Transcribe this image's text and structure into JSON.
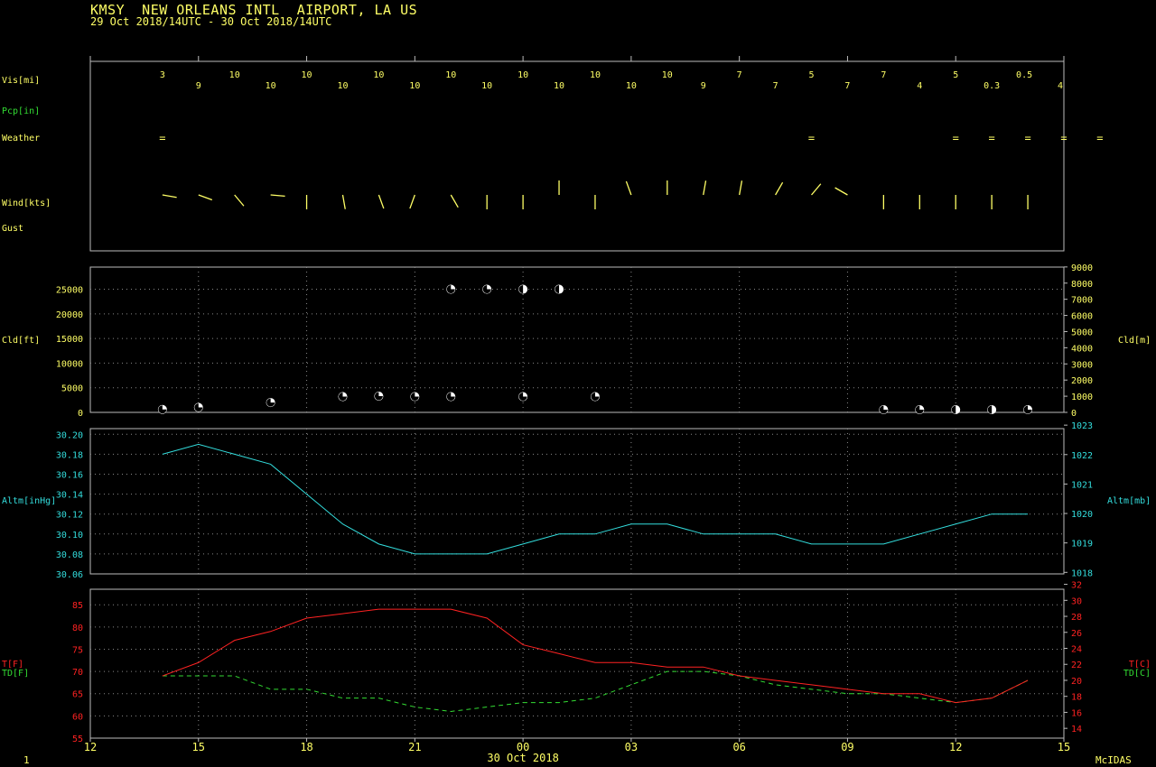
{
  "header": {
    "title": "KMSY  NEW ORLEANS INTL  AIRPORT, LA US",
    "subtitle": "29 Oct 2018/14UTC - 30 Oct 2018/14UTC"
  },
  "footer": {
    "left": "1",
    "right": "McIDAS"
  },
  "colors": {
    "yellow": "#ffff66",
    "green": "#33dd33",
    "cyan": "#33dddd",
    "red": "#ff2222",
    "frame": "#bbbbbb",
    "grid": "#888888"
  },
  "chart_data": {
    "type": "line",
    "hours": [
      14,
      15,
      16,
      17,
      18,
      19,
      20,
      21,
      22,
      23,
      24,
      25,
      26,
      27,
      28,
      29,
      30,
      31,
      32,
      33,
      34,
      35,
      36,
      37,
      38
    ],
    "x_ticks": [
      "12",
      "15",
      "18",
      "21",
      "00",
      "03",
      "06",
      "09",
      "12",
      "15"
    ],
    "x_label": "30 Oct 2018",
    "station_panel": {
      "row_labels": {
        "vis": "Vis[mi]",
        "pcp": "Pcp[in]",
        "weather": "Weather",
        "wind": "Wind[kts]",
        "gust": "Gust"
      },
      "visibility": [
        "3",
        "9",
        "10",
        "10",
        "10",
        "10",
        "10",
        "10",
        "10",
        "10",
        "10",
        "10",
        "10",
        "10",
        "10",
        "9",
        "7",
        "7",
        "5",
        "7",
        "7",
        "4",
        "5",
        "0.3",
        "0.5",
        "4"
      ],
      "visibility_hours": [
        14,
        15,
        16,
        17,
        18,
        19,
        20,
        21,
        22,
        23,
        24,
        25,
        26,
        27,
        28,
        29,
        30,
        31,
        32,
        33,
        34,
        35,
        36,
        37,
        37.9,
        38.9
      ],
      "weather_symbol": "=",
      "weather_hours": [
        14,
        32,
        36,
        37,
        38,
        39,
        40
      ],
      "wind": [
        {
          "dir": 100,
          "len": 1
        },
        {
          "dir": 110,
          "len": 1
        },
        {
          "dir": 140,
          "len": 1
        },
        {
          "dir": 95,
          "len": 1
        },
        {
          "dir": 180,
          "len": 1
        },
        {
          "dir": 170,
          "len": 1
        },
        {
          "dir": 160,
          "len": 1
        },
        {
          "dir": 200,
          "len": 1
        },
        {
          "dir": 150,
          "len": 1
        },
        {
          "dir": 180,
          "len": 1
        },
        {
          "dir": 180,
          "len": 1
        },
        {
          "dir": 0,
          "len": 1
        },
        {
          "dir": 180,
          "len": 1
        },
        {
          "dir": 340,
          "len": 1
        },
        {
          "dir": 0,
          "len": 1
        },
        {
          "dir": 10,
          "len": 1
        },
        {
          "dir": 10,
          "len": 1
        },
        {
          "dir": 30,
          "len": 1
        },
        {
          "dir": 40,
          "len": 1
        },
        {
          "dir": 300,
          "len": 1
        },
        {
          "dir": 180,
          "len": 1
        },
        {
          "dir": 180,
          "len": 1
        },
        {
          "dir": 180,
          "len": 1
        },
        {
          "dir": 180,
          "len": 1
        },
        {
          "dir": 180,
          "len": 1
        }
      ]
    },
    "cloud_panel": {
      "ylabel_left": "Cld[ft]",
      "ylabel_right": "Cld[m]",
      "left_ticks": [
        "0",
        "5000",
        "10000",
        "15000",
        "20000",
        "25000"
      ],
      "right_ticks": [
        "0",
        "1000",
        "2000",
        "3000",
        "4000",
        "5000",
        "6000",
        "7000",
        "8000",
        "9000"
      ],
      "ylim_ft": [
        0,
        29500
      ],
      "layers": [
        {
          "hour": 14,
          "ft": 600,
          "cover": "scattered"
        },
        {
          "hour": 15,
          "ft": 1000,
          "cover": "scattered"
        },
        {
          "hour": 17,
          "ft": 2000,
          "cover": "scattered"
        },
        {
          "hour": 19,
          "ft": 3200,
          "cover": "scattered"
        },
        {
          "hour": 20,
          "ft": 3300,
          "cover": "scattered"
        },
        {
          "hour": 21,
          "ft": 3200,
          "cover": "scattered"
        },
        {
          "hour": 22,
          "ft": 3200,
          "cover": "scattered"
        },
        {
          "hour": 22,
          "ft": 25000,
          "cover": "scattered"
        },
        {
          "hour": 23,
          "ft": 25000,
          "cover": "scattered"
        },
        {
          "hour": 24,
          "ft": 25000,
          "cover": "broken"
        },
        {
          "hour": 24,
          "ft": 3200,
          "cover": "scattered"
        },
        {
          "hour": 25,
          "ft": 25000,
          "cover": "broken"
        },
        {
          "hour": 26,
          "ft": 3200,
          "cover": "scattered"
        },
        {
          "hour": 34,
          "ft": 200,
          "cover": "scattered"
        },
        {
          "hour": 35,
          "ft": 200,
          "cover": "scattered"
        },
        {
          "hour": 36,
          "ft": 200,
          "cover": "broken"
        },
        {
          "hour": 37,
          "ft": 200,
          "cover": "broken"
        },
        {
          "hour": 38,
          "ft": 200,
          "cover": "scattered"
        }
      ]
    },
    "altimeter_panel": {
      "ylabel_left": "Altm[inHg]",
      "ylabel_right": "Altm[mb]",
      "left_ticks": [
        "30.06",
        "30.08",
        "30.10",
        "30.12",
        "30.14",
        "30.16",
        "30.18",
        "30.20"
      ],
      "right_ticks": [
        "1018",
        "1019",
        "1020",
        "1021",
        "1022",
        "1023"
      ],
      "ylim_inhg": [
        30.06,
        30.2
      ],
      "values": [
        30.18,
        30.19,
        30.18,
        30.17,
        30.14,
        30.11,
        30.09,
        30.08,
        30.08,
        30.08,
        30.09,
        30.1,
        30.1,
        30.11,
        30.11,
        30.1,
        30.1,
        30.1,
        30.09,
        30.09,
        30.09,
        30.1,
        30.11,
        30.12,
        30.12
      ]
    },
    "temp_panel": {
      "ylabel_left_t": "T[F]",
      "ylabel_left_td": "TD[F]",
      "ylabel_right_t": "T[C]",
      "ylabel_right_td": "TD[C]",
      "left_ticks": [
        "55",
        "60",
        "65",
        "70",
        "75",
        "80",
        "85"
      ],
      "right_ticks": [
        "14",
        "16",
        "18",
        "20",
        "22",
        "24",
        "26",
        "28",
        "30",
        "32"
      ],
      "ylim_f": [
        55,
        88.5
      ],
      "series": [
        {
          "name": "T[F]",
          "values": [
            69,
            72,
            77,
            79,
            82,
            83,
            84,
            84,
            84,
            82,
            76,
            74,
            72,
            72,
            71,
            71,
            69,
            68,
            67,
            66,
            65,
            65,
            63,
            64,
            68
          ]
        },
        {
          "name": "TD[F]",
          "values": [
            69,
            69,
            69,
            66,
            66,
            64,
            64,
            62,
            61,
            62,
            63,
            63,
            64,
            67,
            70,
            70,
            69,
            67,
            66,
            65,
            65,
            64,
            63,
            64,
            68
          ]
        }
      ]
    }
  }
}
